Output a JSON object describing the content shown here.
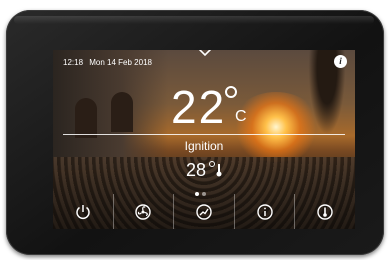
{
  "status_bar": {
    "time": "12:18",
    "date": "Mon 14 Feb 2018"
  },
  "main": {
    "temperature": "22",
    "unit": "C",
    "mode_label": "Ignition",
    "secondary_temperature": "28"
  },
  "icons": {
    "top": "chevron-down-icon",
    "info": "info-icon",
    "bottom": [
      "power-icon",
      "fan-icon",
      "chart-icon",
      "info-icon",
      "thermometer-icon"
    ]
  },
  "info_label": "i",
  "colors": {
    "text": "#ffffff",
    "bezel": "#1a1a1a"
  }
}
